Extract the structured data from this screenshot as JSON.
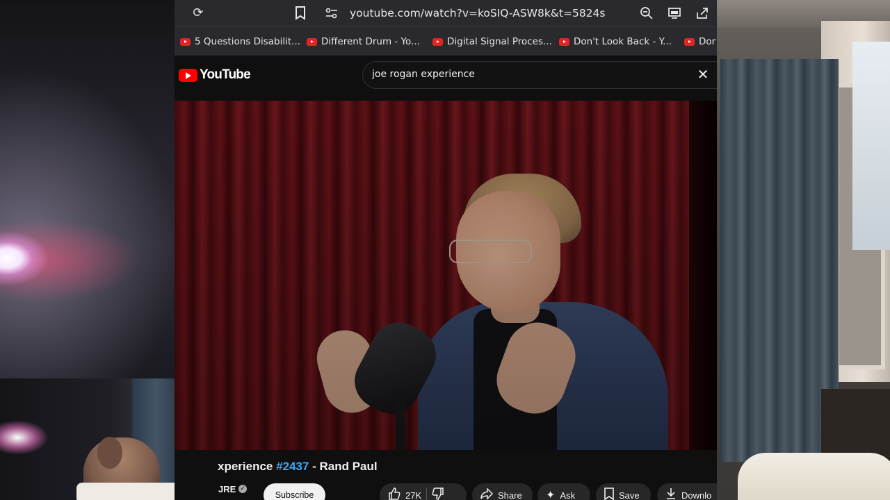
{
  "browser": {
    "url": "youtube.com/watch?v=koSIQ-ASW8k&t=5824s",
    "icons": [
      "reload-icon",
      "bookmark-icon",
      "site-info-icon",
      "zoom-icon",
      "cast-icon",
      "share-icon"
    ],
    "bookmarks": [
      {
        "label": "5 Questions Disabilit..."
      },
      {
        "label": "Different Drum - Yo..."
      },
      {
        "label": "Digital Signal Proces..."
      },
      {
        "label": "Don't Look Back - Y..."
      },
      {
        "label": "Dor"
      }
    ]
  },
  "youtube": {
    "logo_text": "YouTube",
    "search_value": "joe rogan experience",
    "video": {
      "title_prefix": "xperience ",
      "episode": "#2437",
      "title_suffix": " - Rand Paul",
      "channel": "JRE"
    },
    "actions": {
      "subscribe": "Subscribe",
      "likes": "27K",
      "share": "Share",
      "ask": "Ask",
      "save": "Save",
      "download": "Downlo"
    }
  },
  "colors": {
    "brand_red": "#ff0000",
    "link_blue": "#3ea6ff",
    "background": "#0f0f0f"
  }
}
